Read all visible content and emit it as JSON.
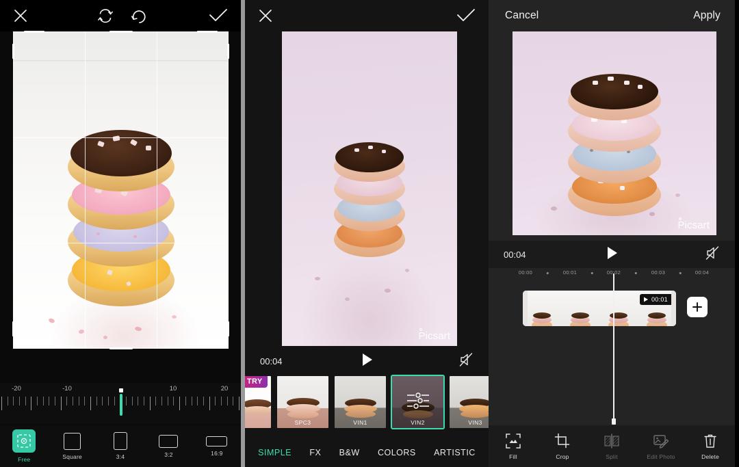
{
  "panel_crop": {
    "name": "crop-editor",
    "topbar": {
      "close_label": "×",
      "rotate_left_icon": "rotate-left-icon",
      "rotate_right_icon": "rotate-right-icon",
      "confirm_icon": "check-icon"
    },
    "ruler": {
      "labels": [
        "-20",
        "-10",
        "10",
        "20"
      ],
      "value": "0",
      "min": "-20",
      "max": "20",
      "accent_color": "#3ddcb0"
    },
    "ratios": [
      {
        "label": "Free",
        "icon": "free-crop-icon",
        "active": true
      },
      {
        "label": "Square",
        "icon": "square-icon",
        "active": false
      },
      {
        "label": "3:4",
        "icon": "portrait-icon",
        "active": false
      },
      {
        "label": "3:2",
        "icon": "landscape-icon",
        "active": false
      },
      {
        "label": "16:9",
        "icon": "widescreen-icon",
        "active": false
      }
    ]
  },
  "panel_filters": {
    "name": "filter-editor",
    "topbar": {
      "close_label": "×",
      "confirm_icon": "check-icon"
    },
    "watermark": "Picsart",
    "player": {
      "time": "00:04",
      "play_icon": "play-icon",
      "mute_icon": "mute-icon"
    },
    "filters": [
      {
        "name": "",
        "badge": "TRY",
        "selected": false
      },
      {
        "name": "SPC3",
        "badge": "",
        "selected": false
      },
      {
        "name": "VIN1",
        "badge": "",
        "selected": false
      },
      {
        "name": "VIN2",
        "badge": "",
        "selected": true
      },
      {
        "name": "VIN3",
        "badge": "",
        "selected": false
      }
    ],
    "tabs": [
      {
        "label": "SIMPLE",
        "active": true
      },
      {
        "label": "FX",
        "active": false
      },
      {
        "label": "B&W",
        "active": false
      },
      {
        "label": "COLORS",
        "active": false
      },
      {
        "label": "ARTISTIC",
        "active": false
      }
    ],
    "accent_color": "#3ddcb0"
  },
  "panel_timeline": {
    "name": "video-timeline-editor",
    "topbar": {
      "cancel_label": "Cancel",
      "apply_label": "Apply"
    },
    "watermark": "Picsart",
    "player": {
      "time": "00:04",
      "play_icon": "play-icon",
      "mute_icon": "mute-icon"
    },
    "timeline": {
      "ticks": [
        "00:00",
        "00:01",
        "00:02",
        "00:03",
        "00:04"
      ],
      "clip_badge": "00:01",
      "add_clip_label": "+"
    },
    "tools": [
      {
        "label": "Fill",
        "icon": "fill-icon",
        "enabled": true
      },
      {
        "label": "Crop",
        "icon": "crop-icon",
        "enabled": true
      },
      {
        "label": "Split",
        "icon": "split-icon",
        "enabled": false
      },
      {
        "label": "Edit Photo",
        "icon": "edit-photo-icon",
        "enabled": false
      },
      {
        "label": "Delete",
        "icon": "trash-icon",
        "enabled": true
      }
    ]
  }
}
